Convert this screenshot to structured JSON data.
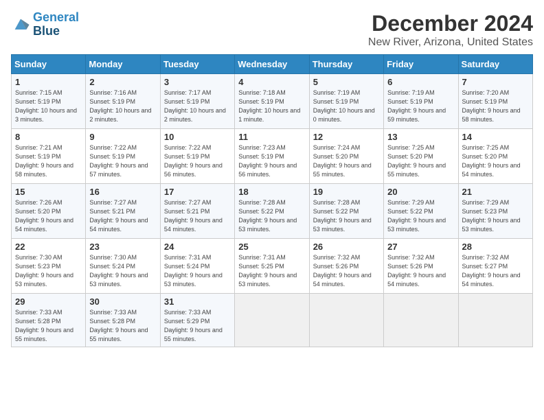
{
  "logo": {
    "line1": "General",
    "line2": "Blue"
  },
  "title": "December 2024",
  "subtitle": "New River, Arizona, United States",
  "days_of_week": [
    "Sunday",
    "Monday",
    "Tuesday",
    "Wednesday",
    "Thursday",
    "Friday",
    "Saturday"
  ],
  "weeks": [
    [
      {
        "day": "1",
        "sunrise": "7:15 AM",
        "sunset": "5:19 PM",
        "daylight": "10 hours and 3 minutes."
      },
      {
        "day": "2",
        "sunrise": "7:16 AM",
        "sunset": "5:19 PM",
        "daylight": "10 hours and 2 minutes."
      },
      {
        "day": "3",
        "sunrise": "7:17 AM",
        "sunset": "5:19 PM",
        "daylight": "10 hours and 2 minutes."
      },
      {
        "day": "4",
        "sunrise": "7:18 AM",
        "sunset": "5:19 PM",
        "daylight": "10 hours and 1 minute."
      },
      {
        "day": "5",
        "sunrise": "7:19 AM",
        "sunset": "5:19 PM",
        "daylight": "10 hours and 0 minutes."
      },
      {
        "day": "6",
        "sunrise": "7:19 AM",
        "sunset": "5:19 PM",
        "daylight": "9 hours and 59 minutes."
      },
      {
        "day": "7",
        "sunrise": "7:20 AM",
        "sunset": "5:19 PM",
        "daylight": "9 hours and 58 minutes."
      }
    ],
    [
      {
        "day": "8",
        "sunrise": "7:21 AM",
        "sunset": "5:19 PM",
        "daylight": "9 hours and 58 minutes."
      },
      {
        "day": "9",
        "sunrise": "7:22 AM",
        "sunset": "5:19 PM",
        "daylight": "9 hours and 57 minutes."
      },
      {
        "day": "10",
        "sunrise": "7:22 AM",
        "sunset": "5:19 PM",
        "daylight": "9 hours and 56 minutes."
      },
      {
        "day": "11",
        "sunrise": "7:23 AM",
        "sunset": "5:19 PM",
        "daylight": "9 hours and 56 minutes."
      },
      {
        "day": "12",
        "sunrise": "7:24 AM",
        "sunset": "5:20 PM",
        "daylight": "9 hours and 55 minutes."
      },
      {
        "day": "13",
        "sunrise": "7:25 AM",
        "sunset": "5:20 PM",
        "daylight": "9 hours and 55 minutes."
      },
      {
        "day": "14",
        "sunrise": "7:25 AM",
        "sunset": "5:20 PM",
        "daylight": "9 hours and 54 minutes."
      }
    ],
    [
      {
        "day": "15",
        "sunrise": "7:26 AM",
        "sunset": "5:20 PM",
        "daylight": "9 hours and 54 minutes."
      },
      {
        "day": "16",
        "sunrise": "7:27 AM",
        "sunset": "5:21 PM",
        "daylight": "9 hours and 54 minutes."
      },
      {
        "day": "17",
        "sunrise": "7:27 AM",
        "sunset": "5:21 PM",
        "daylight": "9 hours and 54 minutes."
      },
      {
        "day": "18",
        "sunrise": "7:28 AM",
        "sunset": "5:22 PM",
        "daylight": "9 hours and 53 minutes."
      },
      {
        "day": "19",
        "sunrise": "7:28 AM",
        "sunset": "5:22 PM",
        "daylight": "9 hours and 53 minutes."
      },
      {
        "day": "20",
        "sunrise": "7:29 AM",
        "sunset": "5:22 PM",
        "daylight": "9 hours and 53 minutes."
      },
      {
        "day": "21",
        "sunrise": "7:29 AM",
        "sunset": "5:23 PM",
        "daylight": "9 hours and 53 minutes."
      }
    ],
    [
      {
        "day": "22",
        "sunrise": "7:30 AM",
        "sunset": "5:23 PM",
        "daylight": "9 hours and 53 minutes."
      },
      {
        "day": "23",
        "sunrise": "7:30 AM",
        "sunset": "5:24 PM",
        "daylight": "9 hours and 53 minutes."
      },
      {
        "day": "24",
        "sunrise": "7:31 AM",
        "sunset": "5:24 PM",
        "daylight": "9 hours and 53 minutes."
      },
      {
        "day": "25",
        "sunrise": "7:31 AM",
        "sunset": "5:25 PM",
        "daylight": "9 hours and 53 minutes."
      },
      {
        "day": "26",
        "sunrise": "7:32 AM",
        "sunset": "5:26 PM",
        "daylight": "9 hours and 54 minutes."
      },
      {
        "day": "27",
        "sunrise": "7:32 AM",
        "sunset": "5:26 PM",
        "daylight": "9 hours and 54 minutes."
      },
      {
        "day": "28",
        "sunrise": "7:32 AM",
        "sunset": "5:27 PM",
        "daylight": "9 hours and 54 minutes."
      }
    ],
    [
      {
        "day": "29",
        "sunrise": "7:33 AM",
        "sunset": "5:28 PM",
        "daylight": "9 hours and 55 minutes."
      },
      {
        "day": "30",
        "sunrise": "7:33 AM",
        "sunset": "5:28 PM",
        "daylight": "9 hours and 55 minutes."
      },
      {
        "day": "31",
        "sunrise": "7:33 AM",
        "sunset": "5:29 PM",
        "daylight": "9 hours and 55 minutes."
      },
      null,
      null,
      null,
      null
    ]
  ]
}
